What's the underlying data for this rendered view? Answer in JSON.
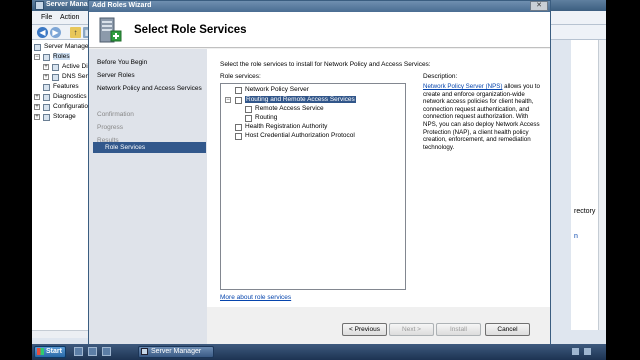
{
  "server_manager": {
    "title": "Server Manager",
    "menu": [
      "File",
      "Action"
    ],
    "tree": [
      {
        "label": "Server Manager",
        "expander": ""
      },
      {
        "label": "Roles",
        "expander": "−"
      },
      {
        "label": "Active Directory",
        "expander": "+"
      },
      {
        "label": "DNS Server",
        "expander": "+"
      },
      {
        "label": "Features",
        "expander": ""
      },
      {
        "label": "Diagnostics",
        "expander": "+"
      },
      {
        "label": "Configuration",
        "expander": "+"
      },
      {
        "label": "Storage",
        "expander": "+"
      }
    ],
    "right_pane": {
      "text1": "rectory",
      "link": "n"
    }
  },
  "wizard": {
    "title": "Add Roles Wizard",
    "heading": "Select Role Services",
    "nav": [
      {
        "label": "Before You Begin",
        "state": "normal"
      },
      {
        "label": "Server Roles",
        "state": "normal"
      },
      {
        "label": "Network Policy and Access Services",
        "state": "normal"
      },
      {
        "label": "Role Services",
        "state": "selected"
      },
      {
        "label": "Confirmation",
        "state": "disabled"
      },
      {
        "label": "Progress",
        "state": "disabled"
      },
      {
        "label": "Results",
        "state": "disabled"
      }
    ],
    "instruction": "Select the role services to install for Network Policy and Access Services:",
    "services_label": "Role services:",
    "description_label": "Description:",
    "services": [
      {
        "label": "Network Policy Server",
        "checked": false,
        "selected": false
      },
      {
        "label": "Routing and Remote Access Services",
        "checked": false,
        "selected": true,
        "expander": "−"
      },
      {
        "label": "Remote Access Service",
        "checked": false,
        "selected": false
      },
      {
        "label": "Routing",
        "checked": false,
        "selected": false
      },
      {
        "label": "Health Registration Authority",
        "checked": false,
        "selected": false
      },
      {
        "label": "Host Credential Authorization Protocol",
        "checked": false,
        "selected": false
      }
    ],
    "description": {
      "link": "Network Policy Server (NPS)",
      "text": " allows you to create and enforce organization-wide network access policies for client health, connection request authentication, and connection request authorization. With NPS, you can also deploy Network Access Protection (NAP), a client health policy creation, enforcement, and remediation technology."
    },
    "more_link": "More about role services",
    "buttons": {
      "previous": "< Previous",
      "next": "Next >",
      "install": "Install",
      "cancel": "Cancel"
    },
    "close_glyph": "✕"
  },
  "taskbar": {
    "start_label": "Start",
    "task_label": "Server Manager"
  },
  "colors": {
    "accent": "#32588c",
    "link": "#0645ad"
  }
}
